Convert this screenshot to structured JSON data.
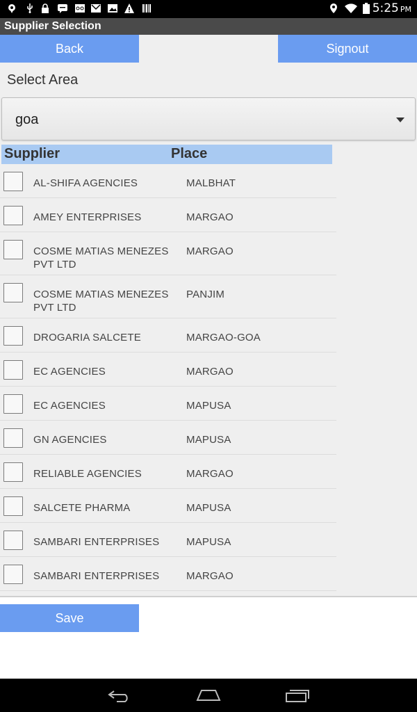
{
  "status_bar": {
    "time": "5:25",
    "ampm": "PM",
    "left_icons": [
      "location-icon",
      "usb-icon",
      "lock-icon",
      "chat-icon",
      "voicemail-icon",
      "gmail-icon",
      "image-icon",
      "warning-icon",
      "barcode-icon"
    ],
    "right_icons": [
      "location-pin-icon",
      "wifi-icon",
      "battery-icon"
    ]
  },
  "title_bar": {
    "title": "Supplier Selection"
  },
  "toolbar": {
    "back_label": "Back",
    "signout_label": "Signout"
  },
  "area": {
    "label": "Select Area",
    "selected": "goa"
  },
  "table": {
    "headers": {
      "supplier": "Supplier",
      "place": "Place"
    },
    "rows": [
      {
        "supplier": "AL-SHIFA AGENCIES",
        "place": "MALBHAT"
      },
      {
        "supplier": "AMEY ENTERPRISES",
        "place": "MARGAO"
      },
      {
        "supplier": "COSME MATIAS MENEZES PVT LTD",
        "place": "MARGAO"
      },
      {
        "supplier": "COSME MATIAS MENEZES PVT LTD",
        "place": "PANJIM"
      },
      {
        "supplier": "DROGARIA SALCETE",
        "place": "MARGAO-GOA"
      },
      {
        "supplier": "EC AGENCIES",
        "place": "MARGAO"
      },
      {
        "supplier": "EC AGENCIES",
        "place": "MAPUSA"
      },
      {
        "supplier": "GN AGENCIES",
        "place": "MAPUSA"
      },
      {
        "supplier": "RELIABLE AGENCIES",
        "place": "MARGAO"
      },
      {
        "supplier": "SALCETE PHARMA",
        "place": "MAPUSA"
      },
      {
        "supplier": "SAMBARI ENTERPRISES",
        "place": "MAPUSA"
      },
      {
        "supplier": "SAMBARI ENTERPRISES",
        "place": "MARGAO"
      }
    ]
  },
  "footer": {
    "save_label": "Save"
  },
  "nav_bar": {
    "icons": [
      "back-icon",
      "home-icon",
      "recent-apps-icon"
    ]
  },
  "colors": {
    "accent": "#6a9cf0",
    "header": "#a9caf2",
    "titlebar": "#4a4a4a"
  }
}
